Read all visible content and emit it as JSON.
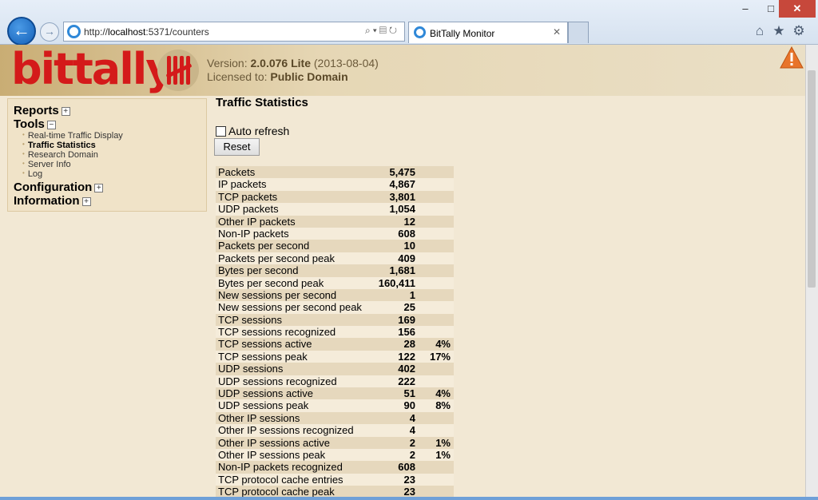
{
  "browser": {
    "url_prefix": "http://",
    "url_host": "localhost",
    "url_path": ":5371/counters",
    "tab_title": "BitTally Monitor",
    "tab_close": "✕",
    "back_glyph": "←",
    "forward_glyph": "→",
    "win_min": "–",
    "win_max": "□",
    "win_close": "✕"
  },
  "banner": {
    "logo": "bittally",
    "version_label": "Version:",
    "version_value": "2.0.076 Lite",
    "version_date": "(2013-08-04)",
    "license_label": "Licensed to:",
    "license_value": "Public Domain"
  },
  "sidebar": {
    "reports": "Reports",
    "tools": "Tools",
    "tool_items": [
      "Real-time Traffic Display",
      "Traffic Statistics",
      "Research Domain",
      "Server Info",
      "Log"
    ],
    "configuration": "Configuration",
    "information": "Information"
  },
  "main": {
    "title": "Traffic Statistics",
    "auto_refresh": "Auto refresh",
    "reset": "Reset"
  },
  "stats": [
    {
      "label": "Packets",
      "value": "5,475",
      "pct": ""
    },
    {
      "label": "IP packets",
      "value": "4,867",
      "pct": ""
    },
    {
      "label": "TCP packets",
      "value": "3,801",
      "pct": ""
    },
    {
      "label": "UDP packets",
      "value": "1,054",
      "pct": ""
    },
    {
      "label": "Other IP packets",
      "value": "12",
      "pct": ""
    },
    {
      "label": "Non-IP packets",
      "value": "608",
      "pct": ""
    },
    {
      "label": "Packets per second",
      "value": "10",
      "pct": ""
    },
    {
      "label": "Packets per second peak",
      "value": "409",
      "pct": ""
    },
    {
      "label": "Bytes per second",
      "value": "1,681",
      "pct": ""
    },
    {
      "label": "Bytes per second peak",
      "value": "160,411",
      "pct": ""
    },
    {
      "label": "New sessions per second",
      "value": "1",
      "pct": ""
    },
    {
      "label": "New sessions per second peak",
      "value": "25",
      "pct": ""
    },
    {
      "label": "TCP sessions",
      "value": "169",
      "pct": ""
    },
    {
      "label": "TCP sessions recognized",
      "value": "156",
      "pct": ""
    },
    {
      "label": "TCP sessions active",
      "value": "28",
      "pct": "4%"
    },
    {
      "label": "TCP sessions peak",
      "value": "122",
      "pct": "17%"
    },
    {
      "label": "UDP sessions",
      "value": "402",
      "pct": ""
    },
    {
      "label": "UDP sessions recognized",
      "value": "222",
      "pct": ""
    },
    {
      "label": "UDP sessions active",
      "value": "51",
      "pct": "4%"
    },
    {
      "label": "UDP sessions peak",
      "value": "90",
      "pct": "8%"
    },
    {
      "label": "Other IP sessions",
      "value": "4",
      "pct": ""
    },
    {
      "label": "Other IP sessions recognized",
      "value": "4",
      "pct": ""
    },
    {
      "label": "Other IP sessions active",
      "value": "2",
      "pct": "1%"
    },
    {
      "label": "Other IP sessions peak",
      "value": "2",
      "pct": "1%"
    },
    {
      "label": "Non-IP packets recognized",
      "value": "608",
      "pct": ""
    },
    {
      "label": "TCP protocol cache entries",
      "value": "23",
      "pct": ""
    },
    {
      "label": "TCP protocol cache peak",
      "value": "23",
      "pct": ""
    }
  ],
  "icons": {
    "back": "back-arrow-icon",
    "forward": "forward-arrow-icon",
    "home": "home-icon",
    "favorites": "star-icon",
    "tools": "gear-icon",
    "warning": "warning-icon"
  },
  "colors": {
    "logo_red": "#d41a1a",
    "page_bg": "#f2e8d4",
    "row_odd": "#e6d8bd",
    "row_even": "#f5ecda"
  }
}
